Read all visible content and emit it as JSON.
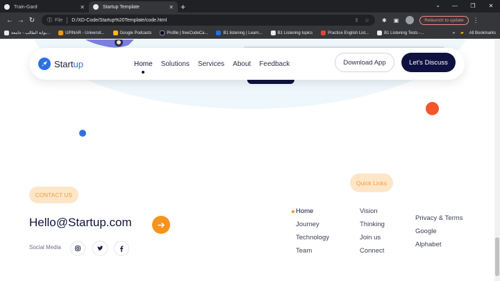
{
  "browser": {
    "tabs": [
      {
        "title": "Train-Gard"
      },
      {
        "title": "Startup Template"
      }
    ],
    "address": {
      "label": "File",
      "url": "D:/XD-Code/Startup%20Template/code.html"
    },
    "relaunch_label": "Relaunch to update",
    "bookmarks": [
      {
        "label": "بوابة الطالب - جامعة...",
        "color": "#e8eaed"
      },
      {
        "label": "UPINAR - Universit...",
        "color": "#f29900"
      },
      {
        "label": "Google Podcasts",
        "color": "#fbbc04"
      },
      {
        "label": "Profile | freeCodeCa...",
        "color": "#0a0a23"
      },
      {
        "label": "B1 listening | Learn...",
        "color": "#1a73e8"
      },
      {
        "label": "B1 Listening topics",
        "color": "#e8eaed"
      },
      {
        "label": "Practice English List...",
        "color": "#ea4335"
      },
      {
        "label": "B1 Listening Tests -...",
        "color": "#e8eaed"
      }
    ],
    "all_bookmarks_label": "All Bookmarks"
  },
  "navbar": {
    "logo_main": "Start",
    "logo_accent": "up",
    "links": [
      {
        "label": "Home",
        "active": true
      },
      {
        "label": "Solutions"
      },
      {
        "label": "Services"
      },
      {
        "label": "About"
      },
      {
        "label": "Feedback"
      }
    ],
    "download_label": "Download App",
    "discuss_label": "Let's Discuss"
  },
  "footer": {
    "contact_badge": "CONTACT US",
    "email": "Hello@Startup.com",
    "social_label": "Social Media",
    "social_icons": [
      "instagram-icon",
      "twitter-icon",
      "facebook-icon"
    ],
    "quick_links_badge": "Quick Links",
    "col1": [
      "Home",
      "Journey",
      "Technology",
      "Team"
    ],
    "col2": [
      "Vision",
      "Thinking",
      "Join us",
      "Connect"
    ],
    "col3": [
      "Privacy & Terms",
      "Google",
      "Alphabet"
    ]
  },
  "colors": {
    "brand_blue": "#2f6fe4",
    "navy": "#0f1240",
    "orange": "#f7941d",
    "badge_bg": "#fde6c8",
    "accent_red": "#f3562a"
  }
}
